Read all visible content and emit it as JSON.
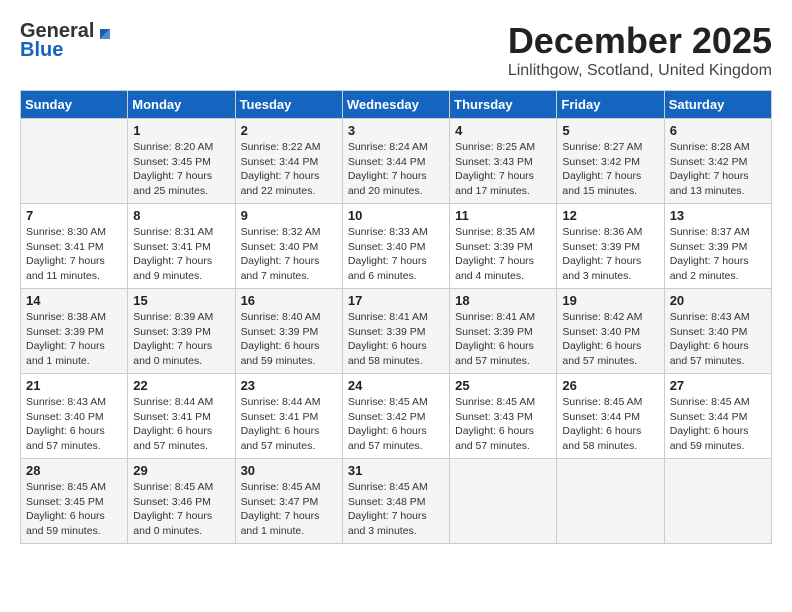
{
  "header": {
    "logo_line1": "General",
    "logo_line2": "Blue",
    "month": "December 2025",
    "location": "Linlithgow, Scotland, United Kingdom"
  },
  "days_of_week": [
    "Sunday",
    "Monday",
    "Tuesday",
    "Wednesday",
    "Thursday",
    "Friday",
    "Saturday"
  ],
  "weeks": [
    [
      {
        "day": "",
        "content": ""
      },
      {
        "day": "1",
        "content": "Sunrise: 8:20 AM\nSunset: 3:45 PM\nDaylight: 7 hours\nand 25 minutes."
      },
      {
        "day": "2",
        "content": "Sunrise: 8:22 AM\nSunset: 3:44 PM\nDaylight: 7 hours\nand 22 minutes."
      },
      {
        "day": "3",
        "content": "Sunrise: 8:24 AM\nSunset: 3:44 PM\nDaylight: 7 hours\nand 20 minutes."
      },
      {
        "day": "4",
        "content": "Sunrise: 8:25 AM\nSunset: 3:43 PM\nDaylight: 7 hours\nand 17 minutes."
      },
      {
        "day": "5",
        "content": "Sunrise: 8:27 AM\nSunset: 3:42 PM\nDaylight: 7 hours\nand 15 minutes."
      },
      {
        "day": "6",
        "content": "Sunrise: 8:28 AM\nSunset: 3:42 PM\nDaylight: 7 hours\nand 13 minutes."
      }
    ],
    [
      {
        "day": "7",
        "content": "Sunrise: 8:30 AM\nSunset: 3:41 PM\nDaylight: 7 hours\nand 11 minutes."
      },
      {
        "day": "8",
        "content": "Sunrise: 8:31 AM\nSunset: 3:41 PM\nDaylight: 7 hours\nand 9 minutes."
      },
      {
        "day": "9",
        "content": "Sunrise: 8:32 AM\nSunset: 3:40 PM\nDaylight: 7 hours\nand 7 minutes."
      },
      {
        "day": "10",
        "content": "Sunrise: 8:33 AM\nSunset: 3:40 PM\nDaylight: 7 hours\nand 6 minutes."
      },
      {
        "day": "11",
        "content": "Sunrise: 8:35 AM\nSunset: 3:39 PM\nDaylight: 7 hours\nand 4 minutes."
      },
      {
        "day": "12",
        "content": "Sunrise: 8:36 AM\nSunset: 3:39 PM\nDaylight: 7 hours\nand 3 minutes."
      },
      {
        "day": "13",
        "content": "Sunrise: 8:37 AM\nSunset: 3:39 PM\nDaylight: 7 hours\nand 2 minutes."
      }
    ],
    [
      {
        "day": "14",
        "content": "Sunrise: 8:38 AM\nSunset: 3:39 PM\nDaylight: 7 hours\nand 1 minute."
      },
      {
        "day": "15",
        "content": "Sunrise: 8:39 AM\nSunset: 3:39 PM\nDaylight: 7 hours\nand 0 minutes."
      },
      {
        "day": "16",
        "content": "Sunrise: 8:40 AM\nSunset: 3:39 PM\nDaylight: 6 hours\nand 59 minutes."
      },
      {
        "day": "17",
        "content": "Sunrise: 8:41 AM\nSunset: 3:39 PM\nDaylight: 6 hours\nand 58 minutes."
      },
      {
        "day": "18",
        "content": "Sunrise: 8:41 AM\nSunset: 3:39 PM\nDaylight: 6 hours\nand 57 minutes."
      },
      {
        "day": "19",
        "content": "Sunrise: 8:42 AM\nSunset: 3:40 PM\nDaylight: 6 hours\nand 57 minutes."
      },
      {
        "day": "20",
        "content": "Sunrise: 8:43 AM\nSunset: 3:40 PM\nDaylight: 6 hours\nand 57 minutes."
      }
    ],
    [
      {
        "day": "21",
        "content": "Sunrise: 8:43 AM\nSunset: 3:40 PM\nDaylight: 6 hours\nand 57 minutes."
      },
      {
        "day": "22",
        "content": "Sunrise: 8:44 AM\nSunset: 3:41 PM\nDaylight: 6 hours\nand 57 minutes."
      },
      {
        "day": "23",
        "content": "Sunrise: 8:44 AM\nSunset: 3:41 PM\nDaylight: 6 hours\nand 57 minutes."
      },
      {
        "day": "24",
        "content": "Sunrise: 8:45 AM\nSunset: 3:42 PM\nDaylight: 6 hours\nand 57 minutes."
      },
      {
        "day": "25",
        "content": "Sunrise: 8:45 AM\nSunset: 3:43 PM\nDaylight: 6 hours\nand 57 minutes."
      },
      {
        "day": "26",
        "content": "Sunrise: 8:45 AM\nSunset: 3:44 PM\nDaylight: 6 hours\nand 58 minutes."
      },
      {
        "day": "27",
        "content": "Sunrise: 8:45 AM\nSunset: 3:44 PM\nDaylight: 6 hours\nand 59 minutes."
      }
    ],
    [
      {
        "day": "28",
        "content": "Sunrise: 8:45 AM\nSunset: 3:45 PM\nDaylight: 6 hours\nand 59 minutes."
      },
      {
        "day": "29",
        "content": "Sunrise: 8:45 AM\nSunset: 3:46 PM\nDaylight: 7 hours\nand 0 minutes."
      },
      {
        "day": "30",
        "content": "Sunrise: 8:45 AM\nSunset: 3:47 PM\nDaylight: 7 hours\nand 1 minute."
      },
      {
        "day": "31",
        "content": "Sunrise: 8:45 AM\nSunset: 3:48 PM\nDaylight: 7 hours\nand 3 minutes."
      },
      {
        "day": "",
        "content": ""
      },
      {
        "day": "",
        "content": ""
      },
      {
        "day": "",
        "content": ""
      }
    ]
  ]
}
